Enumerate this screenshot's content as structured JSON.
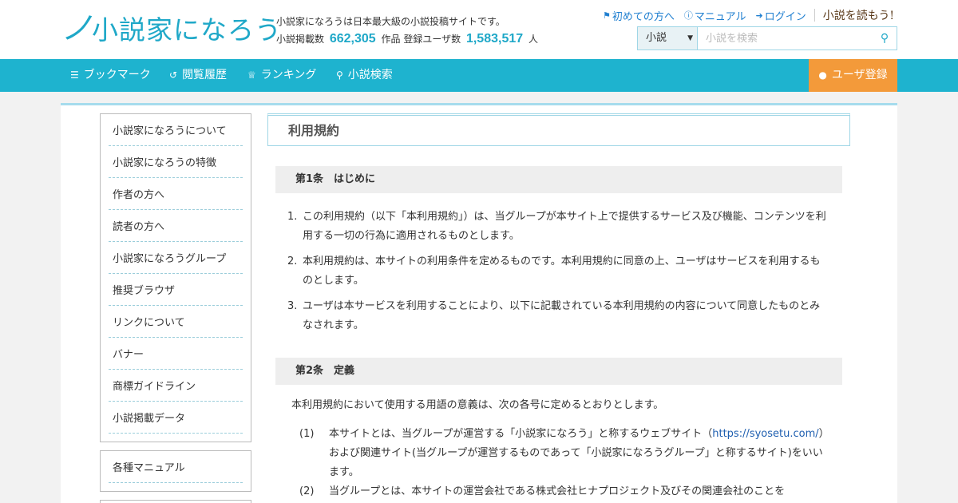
{
  "header": {
    "logo_swirl": "ノ",
    "logo_text": "小説家になろう",
    "site_description": "小説家になろうは日本最大級の小説投稿サイトです。",
    "stats_novel_label": "小説掲載数",
    "stats_novel_count": "662,305",
    "stats_novel_unit": "作品",
    "stats_user_label": "登録ユーザ数",
    "stats_user_count": "1,583,517",
    "stats_user_unit": "人",
    "links": [
      {
        "label": "初めての方へ",
        "icon": "bookmark-icon"
      },
      {
        "label": "マニュアル",
        "icon": "question-circle-icon"
      },
      {
        "label": "ログイン",
        "icon": "login-icon"
      }
    ],
    "yomou_label": "小説を読もう!",
    "search": {
      "select_value": "小説",
      "placeholder": "小説を検索"
    }
  },
  "nav": {
    "items": [
      {
        "label": "ブックマーク",
        "icon": "bookshelf-icon"
      },
      {
        "label": "閲覧履歴",
        "icon": "history-icon"
      },
      {
        "label": "ランキング",
        "icon": "crown-icon"
      },
      {
        "label": "小説検索",
        "icon": "search-icon"
      }
    ],
    "register_label": "ユーザ登録"
  },
  "sidebar": {
    "items": [
      "小説家になろうについて",
      "小説家になろうの特徴",
      "作者の方へ",
      "読者の方へ",
      "小説家になろうグループ",
      "推奨ブラウザ",
      "リンクについて",
      "バナー",
      "商標ガイドライン",
      "小説掲載データ"
    ],
    "manual_label": "各種マニュアル"
  },
  "main": {
    "page_title": "利用規約",
    "article1": {
      "heading": "第1条　はじめに",
      "items": [
        {
          "num": "1.",
          "text": "この利用規約（以下「本利用規約」）は、当グループが本サイト上で提供するサービス及び機能、コンテンツを利用する一切の行為に適用されるものとします。"
        },
        {
          "num": "2.",
          "text": "本利用規約は、本サイトの利用条件を定めるものです。本利用規約に同意の上、ユーザはサービスを利用するものとします。"
        },
        {
          "num": "3.",
          "text": "ユーザは本サービスを利用することにより、以下に記載されている本利用規約の内容について同意したものとみなされます。"
        }
      ]
    },
    "article2": {
      "heading": "第2条　定義",
      "intro": "本利用規約において使用する用語の意義は、次の各号に定めるとおりとします。",
      "def1_num": "(1)",
      "def1_a": "本サイトとは、当グループが運営する「小説家になろう」と称するウェブサイト（",
      "def1_link": "https://syosetu.com/",
      "def1_b": "）および関連サイト(当グループが運営するものであって「小説家になろうグループ」と称するサイト)をいいます。",
      "def2_num": "(2)",
      "def2_text": "当グループとは、本サイトの運営会社である株式会社ヒナプロジェクト及びその関連会社のことを"
    }
  }
}
